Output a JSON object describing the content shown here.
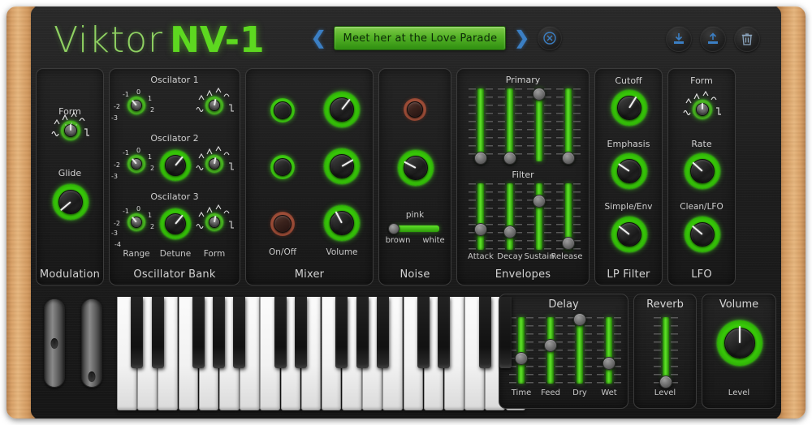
{
  "brand": {
    "word_light": "Viktor",
    "word_bold": "NV-1"
  },
  "header": {
    "prev_icon": "chevron-left-icon",
    "next_icon": "chevron-right-icon",
    "preset_name": "Meet her at the Love Parade",
    "clear_icon": "circle-x-icon",
    "buttons": [
      {
        "name": "import-preset-button",
        "icon": "download-icon"
      },
      {
        "name": "export-preset-button",
        "icon": "upload-icon"
      },
      {
        "name": "delete-preset-button",
        "icon": "trash-icon"
      }
    ]
  },
  "modulation": {
    "title": "Modulation",
    "form_label": "Form",
    "glide_label": "Glide",
    "form_angle": 0,
    "glide_angle": -130
  },
  "oscillator_bank": {
    "title": "Oscillator Bank",
    "osc_labels": [
      "Oscilator 1",
      "Oscilator 2",
      "Oscilator 3"
    ],
    "bottom_labels": [
      "Range",
      "Detune",
      "Form"
    ],
    "range_scale_12": [
      "-3",
      "-2",
      "-1",
      "0",
      "1",
      "2"
    ],
    "range_scale_3": [
      "-4",
      "-3",
      "-2",
      "-1",
      "0",
      "1",
      "2"
    ],
    "osc1_range_angle": -40,
    "osc1_form_angle": 10,
    "osc2_range_angle": -40,
    "osc2_detune_angle": 40,
    "osc2_form_angle": 10,
    "osc3_range_angle": -40,
    "osc3_detune_angle": 40,
    "osc3_form_angle": 10
  },
  "mixer": {
    "title": "Mixer",
    "onoff_label": "On/Off",
    "volume_label": "Volume",
    "leds": [
      "on",
      "on",
      "off"
    ],
    "volume_angles": [
      38,
      60,
      -28
    ]
  },
  "noise": {
    "title": "Noise",
    "led": "off",
    "knob_angle": -62,
    "type_top_label": "pink",
    "type_left_label": "brown",
    "type_right_label": "white",
    "type_value_pct": 4
  },
  "envelopes": {
    "title": "Envelopes",
    "primary_label": "Primary",
    "filter_label": "Filter",
    "stage_labels": [
      "Attack",
      "Decay",
      "Sustain",
      "Release"
    ],
    "primary_values": [
      4,
      4,
      92,
      4
    ],
    "filter_values": [
      30,
      27,
      73,
      10
    ]
  },
  "lp_filter": {
    "title": "LP Filter",
    "labels": [
      "Cutoff",
      "Emphasis",
      "Simple/Env"
    ],
    "angles": [
      32,
      -56,
      -52
    ]
  },
  "lfo": {
    "title": "LFO",
    "labels": [
      "Form",
      "Rate",
      "Clean/LFO"
    ],
    "form_angle": 0,
    "rate_angle": -48,
    "cleanlfo_angle": -50
  },
  "delay": {
    "title": "Delay",
    "labels": [
      "Time",
      "Feed",
      "Dry",
      "Wet"
    ],
    "values": [
      38,
      57,
      96,
      30
    ]
  },
  "reverb": {
    "title": "Reverb",
    "label": "Level",
    "value": 3
  },
  "master": {
    "title": "Volume",
    "label": "Level",
    "angle": 0
  },
  "keyboard": {
    "white_key_count": 20,
    "pitch_wheel": "pitch-bend-wheel",
    "mod_wheel": "modulation-wheel",
    "pitch_pos_pct": 50,
    "mod_pos_pct": 88
  },
  "colors": {
    "accent_green": "#3fd011",
    "led_off_red": "#a2503a",
    "blue_icon": "#3b7fc4",
    "wood": "#d9a065",
    "panel_bg": "#1e1e1e"
  }
}
